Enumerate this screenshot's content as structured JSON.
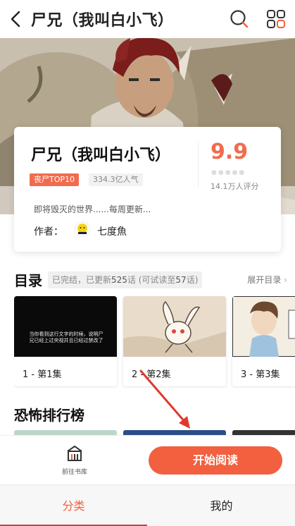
{
  "header": {
    "title": "尸兄（我叫白小飞）",
    "back_icon": "back-arrow-icon",
    "search_icon": "search-icon",
    "menu_icon": "grid-menu-icon"
  },
  "info": {
    "title": "尸兄（我叫白小飞）",
    "rank_tag": "丧尸TOP10",
    "popularity": "334.3亿人气",
    "score": "9.9",
    "score_count": "14.1万人评分",
    "description": "即将毁灭的世界......每周更新...",
    "author_label": "作者：",
    "author_name": "七度魚",
    "colors": {
      "accent": "#f26b4f"
    }
  },
  "catalog": {
    "title": "目录",
    "status_prefix": "已完结，已更新",
    "updated_count": "525",
    "status_mid": "话 (可试读至",
    "free_count": "57",
    "status_suffix": "话)",
    "expand": "展开目录",
    "chapters": [
      {
        "label": "1 - 第1集",
        "thumb_text": "当你看到这行文字的时候，说明尸兄已经上过央视并且已经过禁改了"
      },
      {
        "label": "2 - 第2集"
      },
      {
        "label": "3 - 第3集"
      }
    ]
  },
  "ranking": {
    "title": "恐怖排行榜"
  },
  "actions": {
    "library_label": "前往书库",
    "library_icon": "bookshelf-icon",
    "start_reading": "开始阅读"
  },
  "tabs": [
    {
      "label": "分类",
      "active": true
    },
    {
      "label": "我的",
      "active": false
    }
  ]
}
